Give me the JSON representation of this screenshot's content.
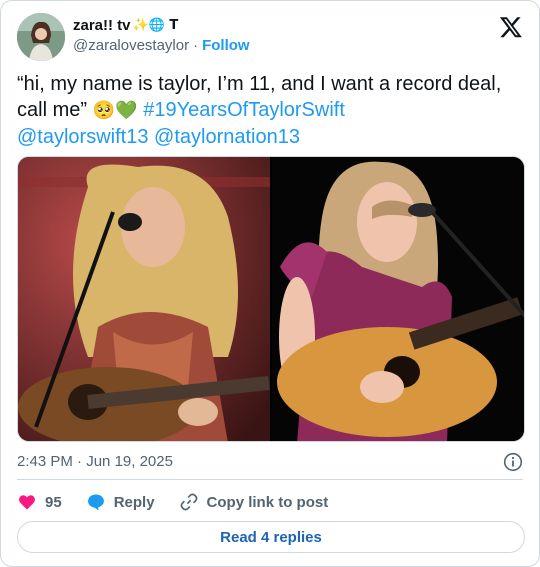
{
  "header": {
    "display_name": "zara!! tv",
    "name_emoji": "✨🌐 T",
    "handle": "@zaralovestaylor",
    "separator": "·",
    "follow_label": "Follow"
  },
  "tweet": {
    "text_main": "“hi, my name is taylor, I’m 11, and I want a record deal, call me”",
    "text_emoji": " 🥺💚 ",
    "hashtag": "#19YearsOfTaylorSwift",
    "mention_1": "@taylorswift13",
    "mention_2": "@taylornation13"
  },
  "meta": {
    "time": "2:43 PM",
    "separator": "·",
    "date": "Jun 19, 2025"
  },
  "actions": {
    "like_count": "95",
    "reply_label": "Reply",
    "copy_label": "Copy link to post"
  },
  "footer": {
    "read_replies_label": "Read 4 replies"
  },
  "colors": {
    "link": "#1d9bf0",
    "like": "#f91880",
    "text": "#0f1419",
    "muted": "#536471",
    "border": "#cfd9de"
  }
}
